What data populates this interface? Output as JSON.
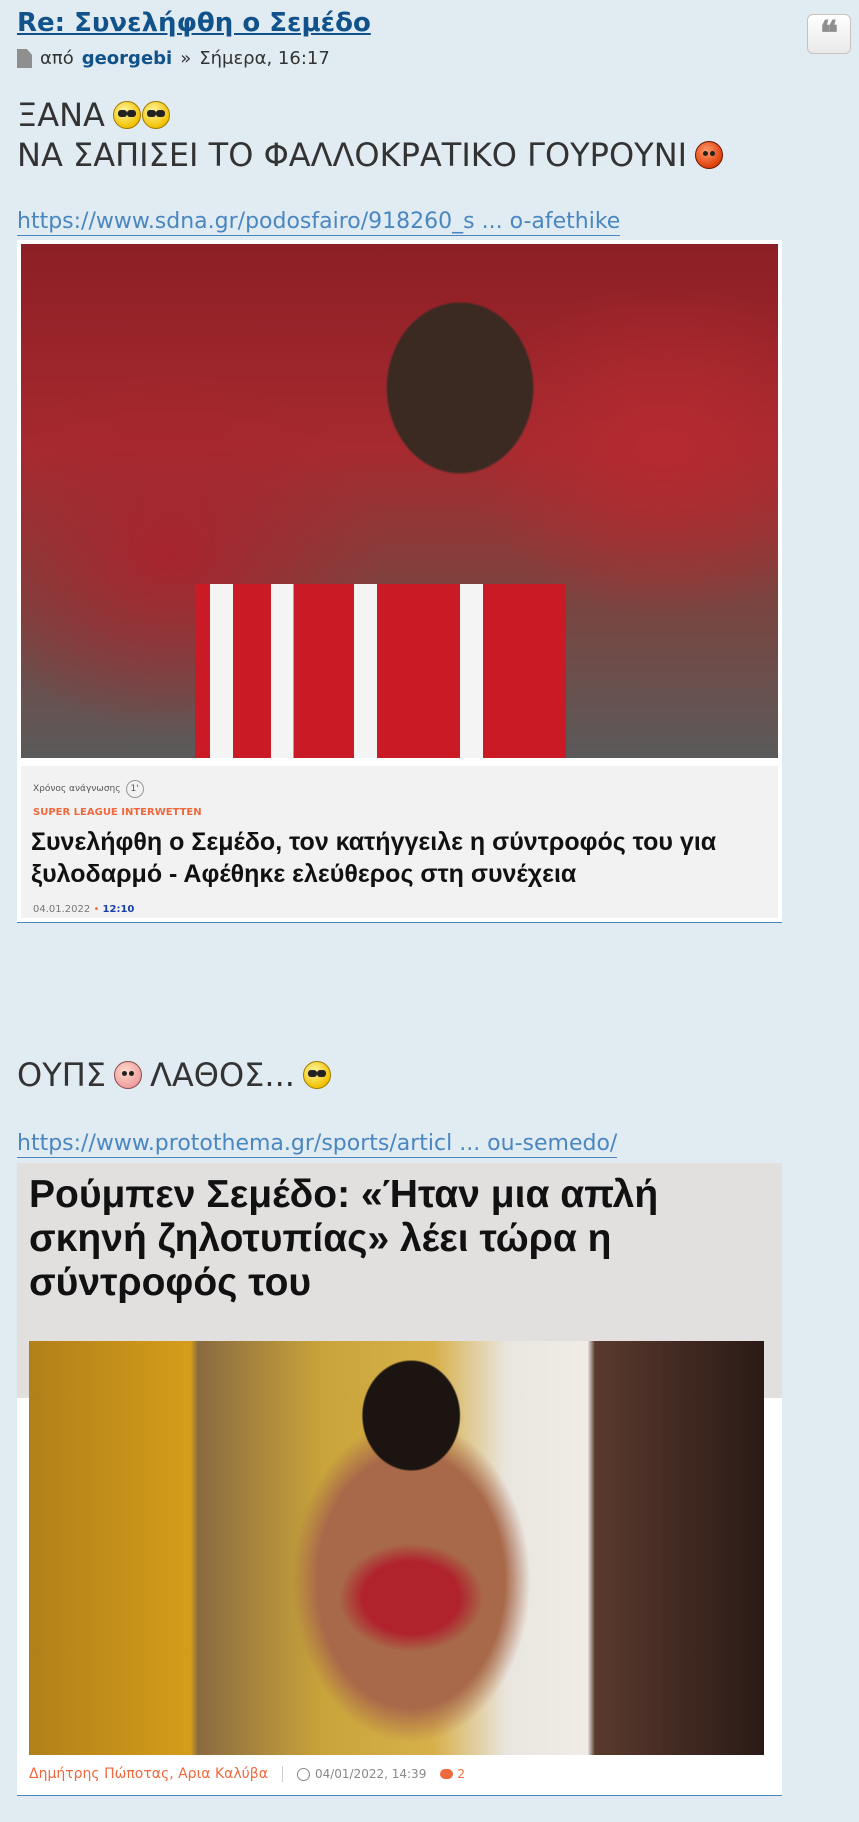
{
  "post": {
    "title": "Re: Συνελήφθη ο Σεμέδο",
    "by_label": "από",
    "author": "georgebi",
    "separator": "»",
    "datetime": "Σήμερα, 16:17"
  },
  "content": {
    "line1": "ΞΑΝΑ",
    "line2": "ΝΑ ΣΑΠΙΣΕΙ ΤΟ ΦΑΛΛΟΚΡΑΤΙΚΟ ΓΟΥΡΟΥΝΙ",
    "link1": "https://www.sdna.gr/podosfairo/918260_s ... o-afethike",
    "line3_a": "ΟΥΠΣ",
    "line3_b": "ΛΑΘΟΣ...",
    "link2": "https://www.protothema.gr/sports/articl ... ou-semedo/"
  },
  "card1": {
    "read_time_label": "Χρόνος ανάγνωσης",
    "read_time_value": "1'",
    "category": "SUPER LEAGUE INTERWETTEN",
    "headline": "Συνελήφθη ο Σεμέδο, τον κατήγγειλε η σύντροφός του για ξυλοδαρμό - Αφέθηκε ελεύθερος στη συνέχεια",
    "date": "04.01.2022",
    "time": "12:10"
  },
  "card2": {
    "headline": "Ρούμπεν Σεμέδο: «Ήταν μια απλή σκηνή ζηλοτυπίας» λέει τώρα η σύντροφός του",
    "authors": "Δημήτρης Πώποτας, Αρια Καλύβα",
    "datetime": "04/01/2022, 14:39",
    "comments": "2"
  },
  "icons": {
    "quote": "quote-icon",
    "file": "file-icon"
  }
}
